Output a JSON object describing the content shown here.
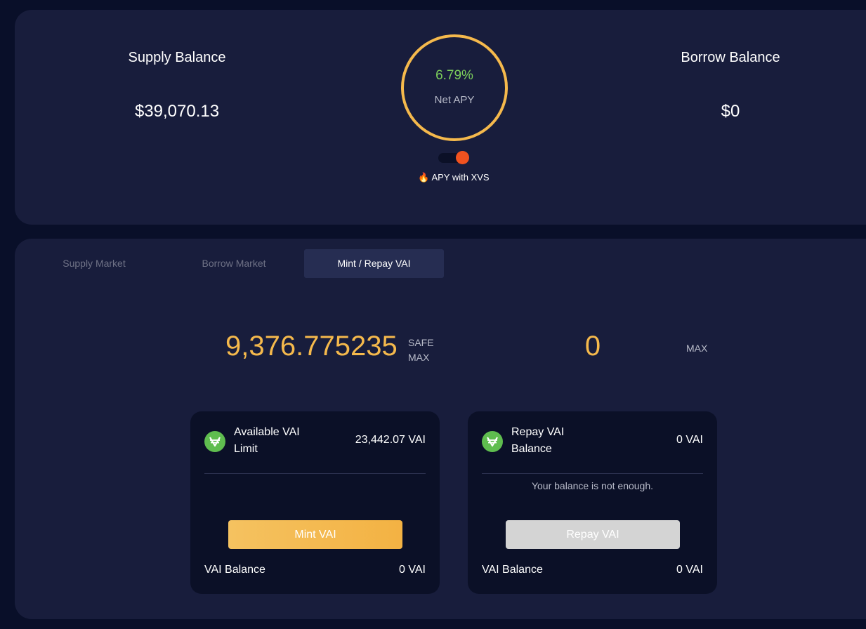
{
  "summary": {
    "supply_label": "Supply Balance",
    "supply_value": "$39,070.13",
    "borrow_label": "Borrow Balance",
    "borrow_value": "$0",
    "net_apy_value": "6.79%",
    "net_apy_label": "Net APY",
    "xvs_toggle_label": "APY with XVS",
    "xvs_toggle_icon": "fire-icon",
    "xvs_toggle_on": true
  },
  "tabs": [
    {
      "label": "Supply Market",
      "active": false
    },
    {
      "label": "Borrow Market",
      "active": false
    },
    {
      "label": "Mint / Repay VAI",
      "active": true
    }
  ],
  "mint": {
    "amount": "9,376.775235",
    "safe_max_line1": "SAFE",
    "safe_max_line2": "MAX",
    "card": {
      "icon": "vai-token-icon",
      "title_line1": "Available VAI",
      "title_line2": "Limit",
      "amount": "23,442.07 VAI",
      "button_label": "Mint VAI",
      "footer_label": "VAI Balance",
      "footer_value": "0 VAI"
    }
  },
  "repay": {
    "amount": "0",
    "max_label": "MAX",
    "card": {
      "icon": "vai-token-icon",
      "title_line1": "Repay VAI",
      "title_line2": "Balance",
      "amount": "0 VAI",
      "note": "Your balance is not enough.",
      "button_label": "Repay VAI",
      "footer_label": "VAI Balance",
      "footer_value": "0 VAI"
    }
  },
  "colors": {
    "accent": "#f5b94c",
    "apy_green": "#7ccf5b",
    "vai_green": "#5fbd4f",
    "toggle_knob": "#f1521f",
    "panel": "#181d3c",
    "background": "#090f29"
  }
}
